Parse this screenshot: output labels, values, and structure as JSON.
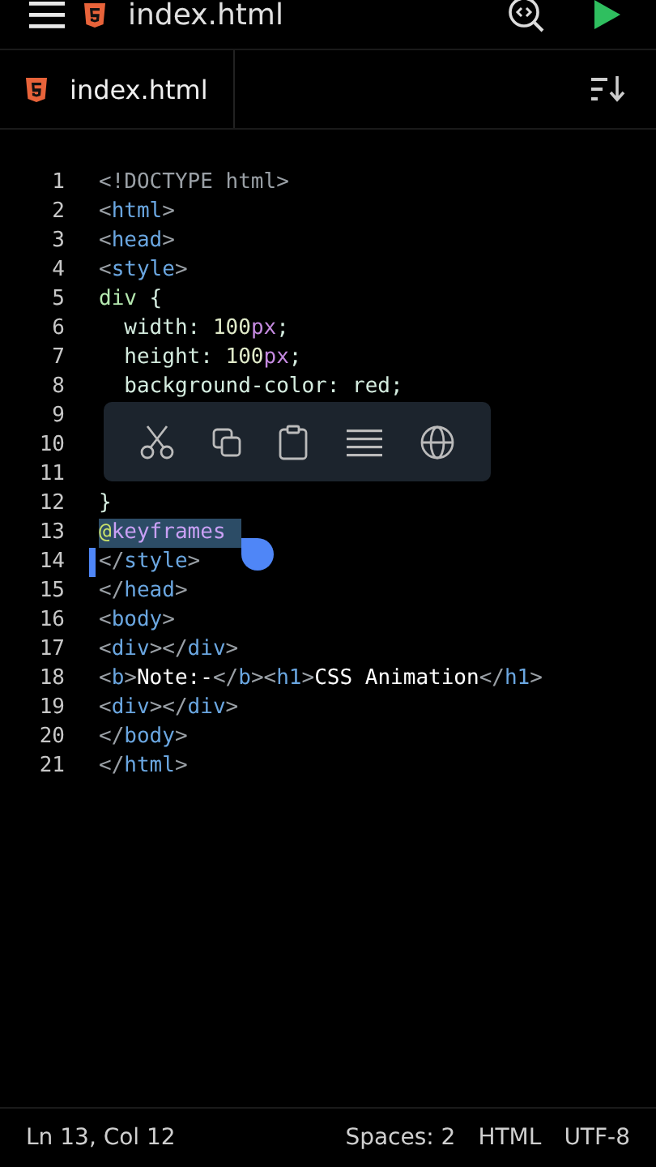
{
  "app_bar": {
    "title": "index.html"
  },
  "tabs": [
    {
      "label": "index.html",
      "selected": true
    }
  ],
  "editor": {
    "lines": [
      {
        "number": "1",
        "tokens": [
          {
            "kind": "punct",
            "text": "<!DOCTYPE html>"
          }
        ]
      },
      {
        "number": "2",
        "tokens": [
          {
            "kind": "punct",
            "text": "<"
          },
          {
            "kind": "tag",
            "text": "html"
          },
          {
            "kind": "punct",
            "text": ">"
          }
        ]
      },
      {
        "number": "3",
        "tokens": [
          {
            "kind": "punct",
            "text": "<"
          },
          {
            "kind": "tag",
            "text": "head"
          },
          {
            "kind": "punct",
            "text": ">"
          }
        ]
      },
      {
        "number": "4",
        "tokens": [
          {
            "kind": "punct",
            "text": "<"
          },
          {
            "kind": "tag",
            "text": "style"
          },
          {
            "kind": "punct",
            "text": ">"
          }
        ]
      },
      {
        "number": "5",
        "tokens": [
          {
            "kind": "selector",
            "text": "div"
          },
          {
            "kind": "plain",
            "text": " {"
          }
        ]
      },
      {
        "number": "6",
        "tokens": [
          {
            "kind": "plain",
            "text": "  width: "
          },
          {
            "kind": "num",
            "text": "100"
          },
          {
            "kind": "unit",
            "text": "px"
          },
          {
            "kind": "plain",
            "text": ";"
          }
        ]
      },
      {
        "number": "7",
        "tokens": [
          {
            "kind": "plain",
            "text": "  height: "
          },
          {
            "kind": "num",
            "text": "100"
          },
          {
            "kind": "unit",
            "text": "px"
          },
          {
            "kind": "plain",
            "text": ";"
          }
        ]
      },
      {
        "number": "8",
        "tokens": [
          {
            "kind": "plain",
            "text": "  background-color: red;"
          }
        ]
      },
      {
        "number": "9"
      },
      {
        "number": "10"
      },
      {
        "number": "11"
      },
      {
        "number": "12",
        "tokens": [
          {
            "kind": "plain",
            "text": "}"
          }
        ]
      },
      {
        "number": "13",
        "tokens": [
          {
            "kind": "at",
            "text": "@"
          },
          {
            "kind": "keyword",
            "text": "keyframes"
          }
        ],
        "selected": true
      },
      {
        "number": "14",
        "tokens": [
          {
            "kind": "punct",
            "text": "</"
          },
          {
            "kind": "tag",
            "text": "style"
          },
          {
            "kind": "punct",
            "text": ">"
          }
        ]
      },
      {
        "number": "15",
        "tokens": [
          {
            "kind": "punct",
            "text": "</"
          },
          {
            "kind": "tag",
            "text": "head"
          },
          {
            "kind": "punct",
            "text": ">"
          }
        ]
      },
      {
        "number": "16",
        "tokens": [
          {
            "kind": "punct",
            "text": "<"
          },
          {
            "kind": "tag",
            "text": "body"
          },
          {
            "kind": "punct",
            "text": ">"
          }
        ]
      },
      {
        "number": "17",
        "tokens": [
          {
            "kind": "punct",
            "text": "<"
          },
          {
            "kind": "tag",
            "text": "div"
          },
          {
            "kind": "punct",
            "text": "></"
          },
          {
            "kind": "tag",
            "text": "div"
          },
          {
            "kind": "punct",
            "text": ">"
          }
        ]
      },
      {
        "number": "18",
        "tokens": [
          {
            "kind": "punct",
            "text": "<"
          },
          {
            "kind": "tag",
            "text": "b"
          },
          {
            "kind": "punct",
            "text": ">"
          },
          {
            "kind": "text",
            "text": "Note:-"
          },
          {
            "kind": "punct",
            "text": "</"
          },
          {
            "kind": "tag",
            "text": "b"
          },
          {
            "kind": "punct",
            "text": "><"
          },
          {
            "kind": "tag",
            "text": "h1"
          },
          {
            "kind": "punct",
            "text": ">"
          },
          {
            "kind": "text",
            "text": "CSS Animation"
          },
          {
            "kind": "punct",
            "text": "</"
          },
          {
            "kind": "tag",
            "text": "h1"
          },
          {
            "kind": "punct",
            "text": ">"
          }
        ]
      },
      {
        "number": "19",
        "tokens": [
          {
            "kind": "punct",
            "text": "<"
          },
          {
            "kind": "tag",
            "text": "div"
          },
          {
            "kind": "punct",
            "text": "></"
          },
          {
            "kind": "tag",
            "text": "div"
          },
          {
            "kind": "punct",
            "text": ">"
          }
        ]
      },
      {
        "number": "20",
        "tokens": [
          {
            "kind": "punct",
            "text": "</"
          },
          {
            "kind": "tag",
            "text": "body"
          },
          {
            "kind": "punct",
            "text": ">"
          }
        ]
      },
      {
        "number": "21",
        "tokens": [
          {
            "kind": "punct",
            "text": "</"
          },
          {
            "kind": "tag",
            "text": "html"
          },
          {
            "kind": "punct",
            "text": ">"
          }
        ]
      }
    ]
  },
  "status_bar": {
    "position": "Ln 13, Col 12",
    "indent": "Spaces: 2",
    "language": "HTML",
    "encoding": "UTF-8"
  }
}
